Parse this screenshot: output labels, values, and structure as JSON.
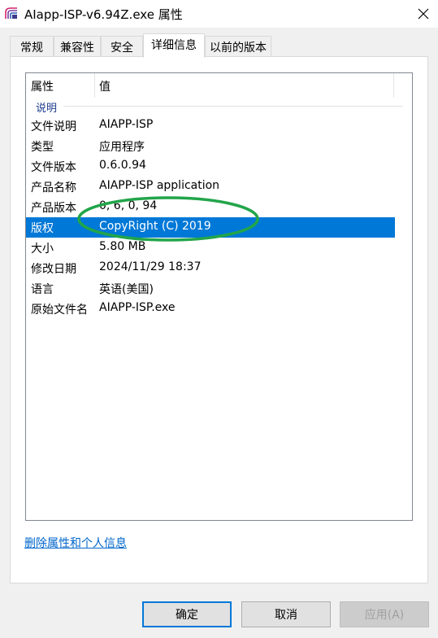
{
  "window": {
    "title": "AIapp-ISP-v6.94Z.exe 属性",
    "close_icon": "close-icon",
    "app_icon": "app-icon"
  },
  "tabs": [
    {
      "label": "常规",
      "active": false
    },
    {
      "label": "兼容性",
      "active": false
    },
    {
      "label": "安全",
      "active": false
    },
    {
      "label": "详细信息",
      "active": true
    },
    {
      "label": "以前的版本",
      "active": false
    }
  ],
  "details": {
    "columns": {
      "property": "属性",
      "value": "值"
    },
    "group": "说明",
    "rows": [
      {
        "property": "文件说明",
        "value": "AIAPP-ISP"
      },
      {
        "property": "类型",
        "value": "应用程序"
      },
      {
        "property": "文件版本",
        "value": "0.6.0.94"
      },
      {
        "property": "产品名称",
        "value": "AIAPP-ISP application"
      },
      {
        "property": "产品版本",
        "value": "0, 6, 0, 94"
      },
      {
        "property": "版权",
        "value": "CopyRight (C) 2019",
        "selected": true
      },
      {
        "property": "大小",
        "value": "5.80 MB"
      },
      {
        "property": "修改日期",
        "value": "2024/11/29 18:37"
      },
      {
        "property": "语言",
        "value": "英语(美国)"
      },
      {
        "property": "原始文件名",
        "value": "AIAPP-ISP.exe"
      }
    ]
  },
  "remove_link": "删除属性和个人信息",
  "buttons": {
    "ok": "确定",
    "cancel": "取消",
    "apply": "应用(A)"
  },
  "colors": {
    "selection": "#0078d7",
    "annotation": "#22a54a",
    "link": "#0066cc"
  }
}
